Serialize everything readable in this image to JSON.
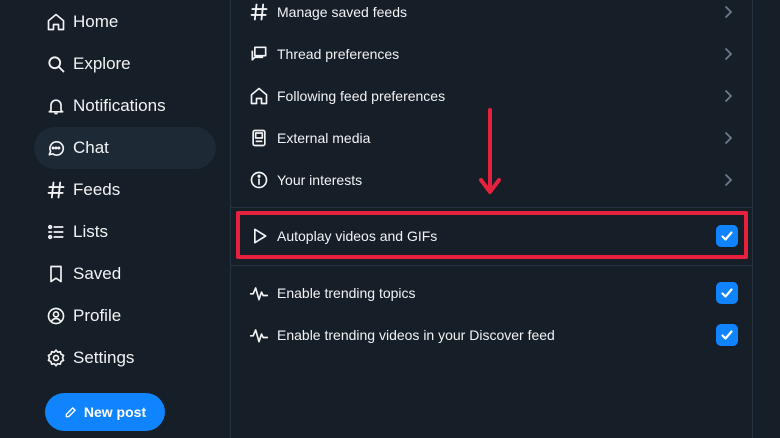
{
  "sidebar": {
    "items": [
      {
        "label": "Home",
        "icon": "home-icon"
      },
      {
        "label": "Explore",
        "icon": "search-icon"
      },
      {
        "label": "Notifications",
        "icon": "bell-icon"
      },
      {
        "label": "Chat",
        "icon": "chat-bubble-icon"
      },
      {
        "label": "Feeds",
        "icon": "hash-icon"
      },
      {
        "label": "Lists",
        "icon": "list-icon"
      },
      {
        "label": "Saved",
        "icon": "bookmark-icon"
      },
      {
        "label": "Profile",
        "icon": "user-circle-icon"
      },
      {
        "label": "Settings",
        "icon": "gear-icon"
      }
    ],
    "active": "Chat",
    "new_post_label": "New post"
  },
  "settings": {
    "links": [
      {
        "label": "Manage saved feeds",
        "icon": "hash-icon"
      },
      {
        "label": "Thread preferences",
        "icon": "thread-bubbles-icon"
      },
      {
        "label": "Following feed preferences",
        "icon": "home-icon"
      },
      {
        "label": "External media",
        "icon": "media-player-icon"
      },
      {
        "label": "Your interests",
        "icon": "info-circle-icon"
      }
    ],
    "autoplay": {
      "label": "Autoplay videos and GIFs",
      "checked": true
    },
    "trending": [
      {
        "label": "Enable trending topics",
        "checked": true
      },
      {
        "label": "Enable trending videos in your Discover feed",
        "checked": true
      }
    ]
  },
  "colors": {
    "background": "#161e27",
    "accent": "#1083fe",
    "highlight": "#e5213d",
    "active_item": "#1e2936"
  }
}
